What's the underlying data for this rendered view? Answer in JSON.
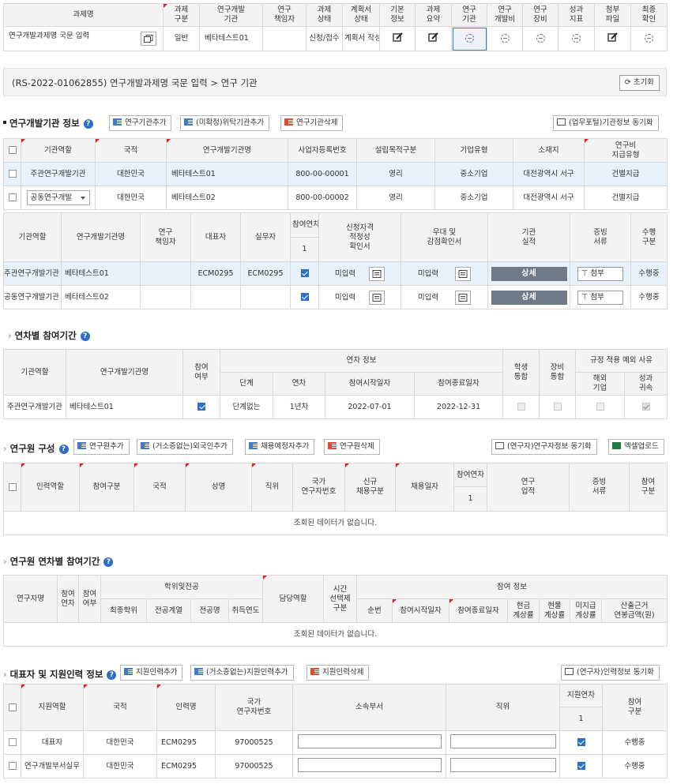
{
  "top_table": {
    "headers": [
      "과제명",
      "과제\n구분",
      "연구개발\n기관",
      "연구\n책임자",
      "과제\n상태",
      "계획서\n상태",
      "기본\n정보",
      "과제\n요약",
      "연구\n기관",
      "연구\n개발비",
      "연구\n장비",
      "성과\n지표",
      "첨부\n파일",
      "최종\n확인"
    ],
    "row": {
      "title": "연구개발과제명 국문 입력",
      "type": "일반",
      "org": "베타테스트01",
      "manager": "",
      "status": "신청/접수",
      "plan_status": "계획서 작성"
    }
  },
  "breadcrumb": {
    "text": "(RS-2022-01062855) 연구개발과제명 국문 입력 > 연구 기관",
    "reset_label": "초기화"
  },
  "org_section": {
    "title": "연구개발기관 정보",
    "buttons": {
      "add": "연구기관추가",
      "add_unconfirmed": "(미확정)위탁기관추가",
      "delete": "연구기관삭제",
      "sync": "(업무포털)기관정보 동기화"
    },
    "headers": [
      "기관역할",
      "국적",
      "연구개발기관명",
      "사업자등록번호",
      "설립목적구분",
      "기업유형",
      "소재지",
      "연구비\n지급유형"
    ],
    "rows": [
      {
        "role": "주관연구개발기관",
        "nation": "대한민국",
        "name": "베타테스트01",
        "bizno": "800-00-00001",
        "purpose": "영리",
        "ctype": "중소기업",
        "location": "대전광역시 서구",
        "paytype": "건별지급"
      },
      {
        "role": "공동연구개발",
        "nation": "대한민국",
        "name": "베타테스트02",
        "bizno": "800-00-00002",
        "purpose": "영리",
        "ctype": "중소기업",
        "location": "대전광역시 서구",
        "paytype": "건별지급"
      }
    ]
  },
  "org_detail": {
    "headers": [
      "기관역할",
      "연구개발기관명",
      "연구\n책임자",
      "대표자",
      "실무자",
      "참여연차",
      "신청자격\n적정성\n확인서",
      "우대 및\n감점확인서",
      "기관\n실적",
      "증빙\n서류",
      "수행\n구분"
    ],
    "year_col": "1",
    "rows": [
      {
        "role": "주관연구개발기관",
        "name": "베타테스트01",
        "manager": "",
        "ceo": "ECM0295",
        "staff": "ECM0295",
        "qual": "미입력",
        "pref": "미입력",
        "detail": "상세",
        "proof": "첨부",
        "state": "수행중"
      },
      {
        "role": "공동연구개발기관",
        "name": "베타테스트02",
        "manager": "",
        "ceo": "",
        "staff": "",
        "qual": "미입력",
        "pref": "미입력",
        "detail": "상세",
        "proof": "첨부",
        "state": "수행중"
      }
    ]
  },
  "year_section": {
    "title": "연차별 참여기간",
    "headers": {
      "role": "기관역할",
      "name": "연구개발기관명",
      "part": "참여\n여부",
      "info": "연차 정보",
      "stage": "단계",
      "year": "연차",
      "start": "참여시작일자",
      "end": "참여종료일자",
      "student": "학생\n통합",
      "equip": "장비\n통합",
      "exc": "규정 적용 예외 사유",
      "overseas": "해외\n기업",
      "perf": "성과\n귀속"
    },
    "row": {
      "role": "주관연구개발기관",
      "name": "베타테스트01",
      "stage": "단계없는",
      "year": "1년차",
      "start": "2022-07-01",
      "end": "2022-12-31"
    }
  },
  "researcher_section": {
    "title": "연구원 구성",
    "buttons": {
      "add": "연구원추가",
      "add_foreign": "(거소증없는)외국인추가",
      "add_planned": "채용예정자추가",
      "delete": "연구원삭제",
      "sync": "(연구자)연구자정보 동기화",
      "excel": "엑셀업로드"
    },
    "headers": [
      "인력역할",
      "참여구분",
      "국적",
      "성명",
      "직위",
      "국가\n연구자번호",
      "신규\n채용구분",
      "채용일자",
      "참여연차",
      "연구\n업적",
      "증빙\n서류",
      "참여\n구분"
    ],
    "year_col": "1",
    "empty": "조회된 데이터가 없습니다."
  },
  "researcher_year_section": {
    "title": "연구원 연차별 참여기간",
    "headers": {
      "name": "연구자명",
      "year": "참여\n연차",
      "part": "참여\n여부",
      "edu": "학위및전공",
      "degree": "최종학위",
      "field": "전공계열",
      "major": "전공명",
      "gradyear": "취득연도",
      "duty": "담당역할",
      "time": "시간\n선택제\n구분",
      "info": "참여 정보",
      "seq": "순번",
      "start": "참여시작일자",
      "end": "참여종료일자",
      "cash": "현금\n계상률",
      "kind": "현물\n계상률",
      "unpaid": "미지급\n계상률",
      "annual": "산출근거\n연봉금액(원)"
    },
    "empty": "조회된 데이터가 없습니다."
  },
  "support_section": {
    "title": "대표자 및 지원인력 정보",
    "buttons": {
      "add": "지원인력추가",
      "add_foreign": "(거소증없는)지원인력추가",
      "delete": "지원인력삭제",
      "sync": "(연구자)인력정보 동기화"
    },
    "headers": [
      "지원역할",
      "국적",
      "인력명",
      "국가\n연구자번호",
      "소속부서",
      "직위",
      "지원연차",
      "참여\n구분"
    ],
    "year_col": "1",
    "rows": [
      {
        "role": "대표자",
        "nation": "대한민국",
        "name": "ECM0295",
        "no": "97000525",
        "state": "수행중"
      },
      {
        "role": "연구개발부서실무",
        "nation": "대한민국",
        "name": "ECM0295",
        "no": "97000525",
        "state": "수행중"
      }
    ]
  }
}
